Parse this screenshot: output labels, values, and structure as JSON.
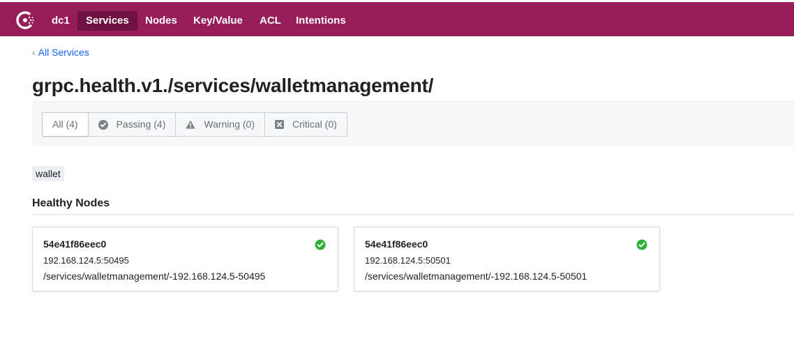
{
  "nav": {
    "logo_icon": "consul-logo-icon",
    "datacenter": "dc1",
    "items": [
      {
        "label": "Services",
        "active": true
      },
      {
        "label": "Nodes",
        "active": false
      },
      {
        "label": "Key/Value",
        "active": false
      },
      {
        "label": "ACL",
        "active": false
      },
      {
        "label": "Intentions",
        "active": false
      }
    ]
  },
  "breadcrumb": {
    "label": "All Services",
    "icon": "chevron-left-icon"
  },
  "title": "grpc.health.v1./services/walletmanagement/",
  "filters": [
    {
      "label": "All (4)",
      "icon": null,
      "selected": true
    },
    {
      "label": "Passing (4)",
      "icon": "check-circle-icon",
      "selected": false
    },
    {
      "label": "Warning (0)",
      "icon": "warning-triangle-icon",
      "selected": false
    },
    {
      "label": "Critical (0)",
      "icon": "x-square-icon",
      "selected": false
    }
  ],
  "tags": [
    "wallet"
  ],
  "healthy_nodes": {
    "title": "Healthy Nodes",
    "nodes": [
      {
        "name": "54e41f86eec0",
        "address": "192.168.124.5:50495",
        "check": "/services/walletmanagement/-192.168.124.5-50495",
        "status_icon": "check-circle-icon"
      },
      {
        "name": "54e41f86eec0",
        "address": "192.168.124.5:50501",
        "check": "/services/walletmanagement/-192.168.124.5-50501",
        "status_icon": "check-circle-icon"
      }
    ]
  },
  "colors": {
    "brand": "#961d59",
    "nav_active": "#6e1242",
    "link": "#1563ff",
    "success": "#2eb039"
  }
}
